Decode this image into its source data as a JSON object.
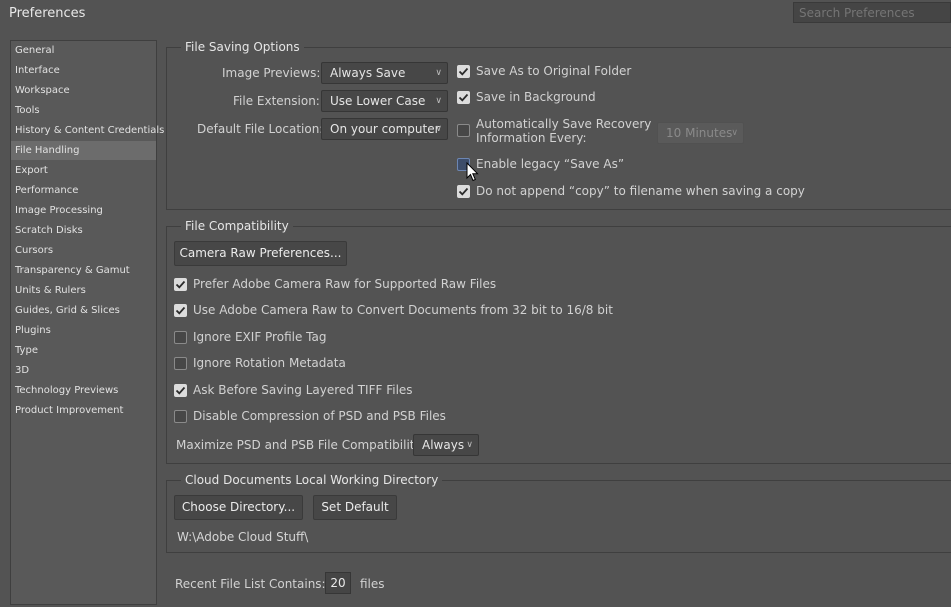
{
  "window": {
    "title": "Preferences"
  },
  "search": {
    "placeholder": "Search Preferences"
  },
  "sidebar": {
    "items": [
      {
        "label": "General"
      },
      {
        "label": "Interface"
      },
      {
        "label": "Workspace"
      },
      {
        "label": "Tools"
      },
      {
        "label": "History & Content Credentials"
      },
      {
        "label": "File Handling"
      },
      {
        "label": "Export"
      },
      {
        "label": "Performance"
      },
      {
        "label": "Image Processing"
      },
      {
        "label": "Scratch Disks"
      },
      {
        "label": "Cursors"
      },
      {
        "label": "Transparency & Gamut"
      },
      {
        "label": "Units & Rulers"
      },
      {
        "label": "Guides, Grid & Slices"
      },
      {
        "label": "Plugins"
      },
      {
        "label": "Type"
      },
      {
        "label": "3D"
      },
      {
        "label": "Technology Previews"
      },
      {
        "label": "Product Improvement"
      }
    ],
    "active": "File Handling"
  },
  "file_saving": {
    "title": "File Saving Options",
    "image_previews_label": "Image Previews:",
    "image_previews_value": "Always Save",
    "file_extension_label": "File Extension:",
    "file_extension_value": "Use Lower Case",
    "default_location_label": "Default File Location:",
    "default_location_value": "On your computer",
    "save_as_original": {
      "label": "Save As to Original Folder",
      "checked": true
    },
    "save_background": {
      "label": "Save in Background",
      "checked": true
    },
    "auto_save_line1": "Automatically Save Recovery",
    "auto_save_line2": "Information Every:",
    "auto_save_checked": false,
    "auto_save_interval": "10 Minutes",
    "legacy_save_as": {
      "label": "Enable legacy “Save As”",
      "checked": false
    },
    "no_copy": {
      "label": "Do not append “copy” to filename when saving a copy",
      "checked": true
    }
  },
  "file_compat": {
    "title": "File Compatibility",
    "camera_raw_button": "Camera Raw Preferences...",
    "prefer_acr": {
      "label": "Prefer Adobe Camera Raw for Supported Raw Files",
      "checked": true
    },
    "use_acr_convert": {
      "label": "Use Adobe Camera Raw to Convert Documents from 32 bit to 16/8 bit",
      "checked": true
    },
    "ignore_exif": {
      "label": "Ignore EXIF Profile Tag",
      "checked": false
    },
    "ignore_rotation": {
      "label": "Ignore Rotation Metadata",
      "checked": false
    },
    "ask_tiff": {
      "label": "Ask Before Saving Layered TIFF Files",
      "checked": true
    },
    "disable_compression": {
      "label": "Disable Compression of PSD and PSB Files",
      "checked": false
    },
    "maximize_label": "Maximize PSD and PSB File Compatibility:",
    "maximize_value": "Always"
  },
  "cloud": {
    "title": "Cloud Documents Local Working Directory",
    "choose_button": "Choose Directory...",
    "default_button": "Set Default",
    "path": "W:\\Adobe Cloud Stuff\\"
  },
  "recent": {
    "label": "Recent File List Contains:",
    "value": "20",
    "suffix": "files"
  },
  "colors": {
    "background": "#535353",
    "active_item": "#6c6c6c",
    "checkbox_on": "#dcdcdc"
  }
}
